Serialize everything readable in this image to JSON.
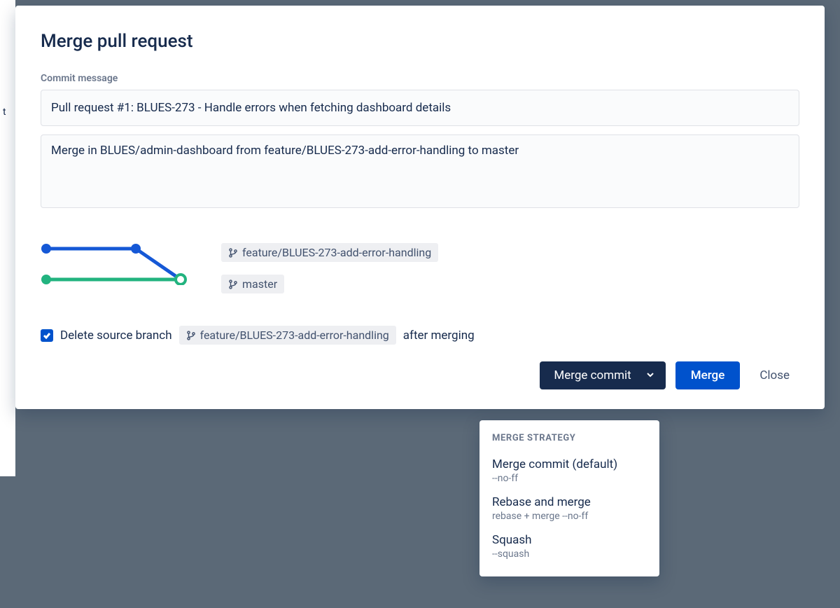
{
  "modal": {
    "title": "Merge pull request",
    "commit_message_label": "Commit message",
    "commit_title": "Pull request #1: BLUES-273 - Handle errors when fetching dashboard details",
    "commit_desc": "Merge in BLUES/admin-dashboard from feature/BLUES-273-add-error-handling to master",
    "source_branch": "feature/BLUES-273-add-error-handling",
    "target_branch": "master",
    "delete_label_prefix": "Delete source branch",
    "delete_branch_name": "feature/BLUES-273-add-error-handling",
    "delete_label_suffix": "after merging",
    "delete_checked": true
  },
  "footer": {
    "strategy_button": "Merge commit",
    "merge_button": "Merge",
    "close_button": "Close"
  },
  "dropdown": {
    "header": "MERGE STRATEGY",
    "items": [
      {
        "label": "Merge commit (default)",
        "sub": "--no-ff"
      },
      {
        "label": "Rebase and merge",
        "sub": "rebase + merge --no-ff"
      },
      {
        "label": "Squash",
        "sub": "--squash"
      }
    ]
  },
  "colors": {
    "blue": "#1558d6",
    "green": "#22b37f",
    "primary": "#0052CC",
    "navy": "#172B4D"
  }
}
